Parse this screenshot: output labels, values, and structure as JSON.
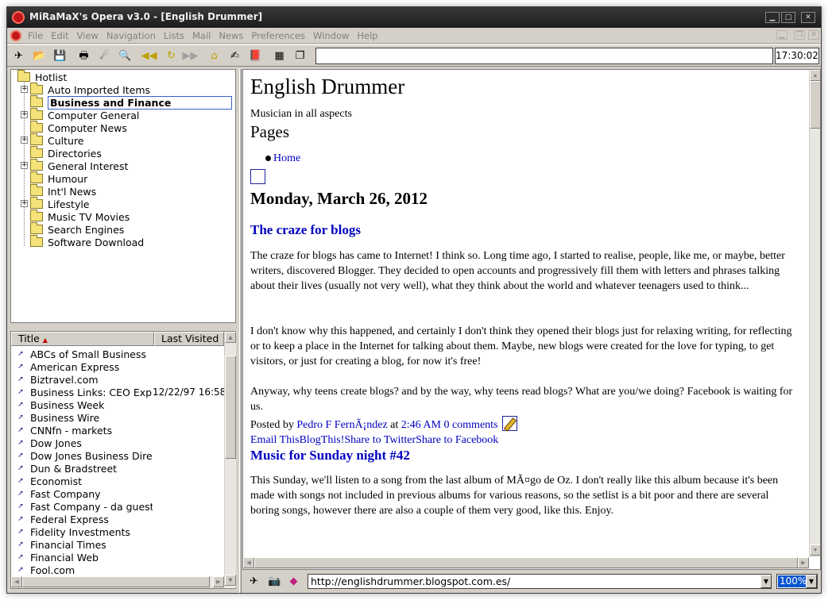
{
  "window": {
    "title": "MiRaMaX's Opera v3.0 - [English Drummer]",
    "clock": "17:30:02"
  },
  "menu": [
    "File",
    "Edit",
    "View",
    "Navigation",
    "Lists",
    "Mail",
    "News",
    "Preferences",
    "Window",
    "Help"
  ],
  "hotlist": {
    "root": "Hotlist",
    "folders": [
      {
        "label": "Auto Imported Items",
        "expandable": true
      },
      {
        "label": "Business and Finance",
        "expandable": false,
        "selected": true
      },
      {
        "label": "Computer General",
        "expandable": true
      },
      {
        "label": "Computer News",
        "expandable": false
      },
      {
        "label": "Culture",
        "expandable": true
      },
      {
        "label": "Directories",
        "expandable": false
      },
      {
        "label": "General Interest",
        "expandable": true
      },
      {
        "label": "Humour",
        "expandable": false
      },
      {
        "label": "Int'l News",
        "expandable": false
      },
      {
        "label": "Lifestyle",
        "expandable": true
      },
      {
        "label": "Music TV Movies",
        "expandable": false
      },
      {
        "label": "Search Engines",
        "expandable": false
      },
      {
        "label": "Software Download",
        "expandable": false
      }
    ]
  },
  "bookmarks": {
    "columns": {
      "title": "Title",
      "last_visited": "Last Visited"
    },
    "sort_indicator": "▲",
    "items": [
      {
        "title": "ABCs of Small Business",
        "visited": ""
      },
      {
        "title": "American Express",
        "visited": ""
      },
      {
        "title": "Biztravel.com",
        "visited": ""
      },
      {
        "title": "Business Links: CEO Express",
        "visited": "12/22/97 16:58"
      },
      {
        "title": "Business Week",
        "visited": ""
      },
      {
        "title": "Business Wire",
        "visited": ""
      },
      {
        "title": "CNNfn - markets",
        "visited": ""
      },
      {
        "title": "Dow Jones",
        "visited": ""
      },
      {
        "title": "Dow Jones Business Directory",
        "visited": ""
      },
      {
        "title": "Dun & Bradstreet",
        "visited": ""
      },
      {
        "title": "Economist",
        "visited": ""
      },
      {
        "title": "Fast Company",
        "visited": ""
      },
      {
        "title": "Fast Company - da guest",
        "visited": ""
      },
      {
        "title": "Federal Express",
        "visited": ""
      },
      {
        "title": "Fidelity Investments",
        "visited": ""
      },
      {
        "title": "Financial Times",
        "visited": ""
      },
      {
        "title": "Financial Web",
        "visited": ""
      },
      {
        "title": "Fool.com",
        "visited": ""
      }
    ]
  },
  "page": {
    "blog_title": "English Drummer",
    "description": "Musician in all aspects",
    "pages_heading": "Pages",
    "home_link": "Home",
    "date": "Monday, March 26, 2012",
    "post1": {
      "title": "The craze for blogs",
      "para1": "The craze for blogs has came to Internet! I think so. Long time ago, I started to realise, people, like me, or maybe, better writers, discovered Blogger. They decided to open accounts and progressively fill them with letters and phrases talking about their lives (usually not very well), what they think about the world and whatever teenagers used to think...",
      "para2": "I don't know why this happened, and certainly I don't think they opened their blogs just for relaxing writing, for reflecting or to keep a place in the Internet for talking about them. Maybe, new blogs were created for the love for typing, to get visitors, or just for creating a blog, for now it's free!",
      "para3": "Anyway, why teens create blogs? and by the way, why teens read blogs? What are you/we doing? Facebook is waiting for us.",
      "posted_by": "Posted by",
      "author": "Pedro F FernÃ¡ndez",
      "at": "at",
      "time": "2:46 AM",
      "comments": "0 comments",
      "share_email": "Email This",
      "share_blog": "BlogThis!",
      "share_twitter": "Share to Twitter",
      "share_facebook": "Share to Facebook"
    },
    "post2": {
      "title": "Music for Sunday night #42",
      "para1": "This Sunday, we'll listen to a song from the last album of MÃ¤go de Oz. I don't really like this album because it's been made with songs not included in previous albums for various reasons, so the setlist is a bit poor and there are several boring songs, however there are also a couple of them very good, like this. Enjoy."
    }
  },
  "bottom": {
    "url": "http://englishdrummer.blogspot.com.es/",
    "zoom": "100%"
  }
}
